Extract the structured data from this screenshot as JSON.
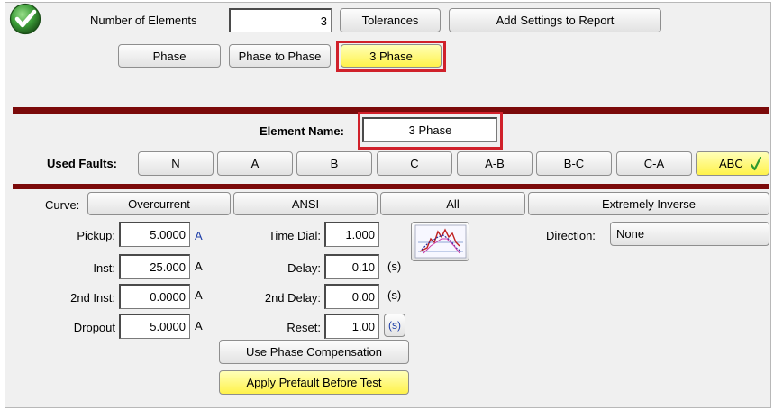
{
  "header": {
    "number_of_elements_label": "Number of Elements",
    "number_of_elements_value": "3",
    "tolerances_button": "Tolerances",
    "add_settings_button": "Add Settings to Report"
  },
  "modes": {
    "phase": "Phase",
    "phase_to_phase": "Phase to Phase",
    "three_phase": "3 Phase",
    "selected": "3 Phase"
  },
  "element": {
    "name_label": "Element Name:",
    "name_value": "3 Phase"
  },
  "faults": {
    "label": "Used Faults:",
    "items": [
      "N",
      "A",
      "B",
      "C",
      "A-B",
      "B-C",
      "C-A",
      "ABC"
    ],
    "selected": "ABC"
  },
  "curve": {
    "label": "Curve:",
    "type": "Overcurrent",
    "standard": "ANSI",
    "scope": "All",
    "shape": "Extremely Inverse"
  },
  "settings": {
    "pickup_label": "Pickup:",
    "pickup_value": "5.0000",
    "pickup_unit": "A",
    "inst_label": "Inst:",
    "inst_value": "25.000",
    "inst_unit": "A",
    "inst2_label": "2nd Inst:",
    "inst2_value": "0.0000",
    "inst2_unit": "A",
    "dropout_label": "Dropout",
    "dropout_value": "5.0000",
    "dropout_unit": "A",
    "time_dial_label": "Time Dial:",
    "time_dial_value": "1.000",
    "delay_label": "Delay:",
    "delay_value": "0.10",
    "delay_unit": "(s)",
    "delay2_label": "2nd Delay:",
    "delay2_value": "0.00",
    "delay2_unit": "(s)",
    "reset_label": "Reset:",
    "reset_value": "1.00",
    "reset_unit": "(s)",
    "direction_label": "Direction:",
    "direction_value": "None"
  },
  "actions": {
    "phase_compensation": "Use Phase Compensation",
    "apply_prefault": "Apply Prefault Before Test"
  },
  "icons": {
    "status": "check-circle-icon",
    "curve_graph": "curve-graph-icon"
  },
  "colors": {
    "accent_yellow": "#fff24a",
    "highlight_red": "#d0202a",
    "divider": "#7b0a0a",
    "link_blue": "#1f3fa8",
    "check_green": "#2e9a2e"
  }
}
